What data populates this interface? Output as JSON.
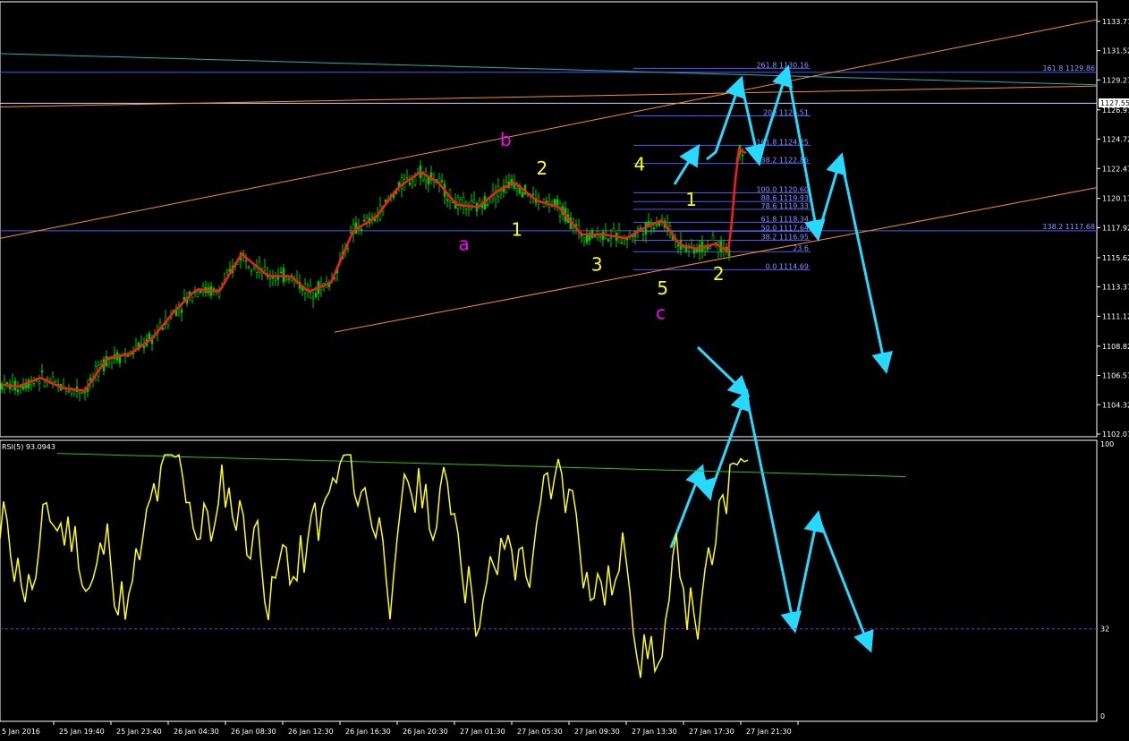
{
  "chart_data": [
    {
      "type": "candlestick",
      "panel": "price",
      "ylim": [
        1102.0,
        1135.0
      ],
      "y_ticks": [
        "1133.77",
        "1131.52",
        "1129.27",
        "1126.97",
        "1124.72",
        "1122.47",
        "1120.17",
        "1117.92",
        "1115.62",
        "1113.37",
        "1111.12",
        "1108.82",
        "1106.57",
        "1104.32",
        "1102.07"
      ],
      "current_price_label": "1127.55",
      "series_red_ma_note": "",
      "wave_labels": [
        {
          "text": "a",
          "color": "#ff00ff",
          "price": 1116.2,
          "t": 0.418
        },
        {
          "text": "b",
          "color": "#ff00ff",
          "price": 1124.2,
          "t": 0.456
        },
        {
          "text": "c",
          "color": "#ff00ff",
          "price": 1110.9,
          "t": 0.598
        },
        {
          "text": "1",
          "color": "#ffff00",
          "price": 1117.3,
          "t": 0.466
        },
        {
          "text": "2",
          "color": "#ffff00",
          "price": 1122.0,
          "t": 0.489
        },
        {
          "text": "3",
          "color": "#ffff00",
          "price": 1114.6,
          "t": 0.539
        },
        {
          "text": "4",
          "color": "#ffff00",
          "price": 1122.3,
          "t": 0.578
        },
        {
          "text": "5",
          "color": "#ffff00",
          "price": 1112.8,
          "t": 0.599
        },
        {
          "text": "1",
          "color": "#ffff00",
          "price": 1119.6,
          "t": 0.625
        },
        {
          "text": "2",
          "color": "#ffff00",
          "price": 1113.9,
          "t": 0.65
        }
      ],
      "fib_levels": [
        {
          "label": "261.8  1130.16",
          "price": 1130.16
        },
        {
          "label": "200  1126.51",
          "price": 1126.51
        },
        {
          "label": "161.8  1124.25",
          "price": 1124.25
        },
        {
          "label": "138.2  1122.86",
          "price": 1122.86
        },
        {
          "label": "100.0  1120.60",
          "price": 1120.6
        },
        {
          "label": "88.6  1119.93",
          "price": 1119.93
        },
        {
          "label": "78.6  1119.33",
          "price": 1119.33
        },
        {
          "label": "61.8  1118.34",
          "price": 1118.34
        },
        {
          "label": "50.0  1117.64",
          "price": 1117.64
        },
        {
          "label": "38.2  1116.95",
          "price": 1116.95
        },
        {
          "label": "23.6",
          "price": 1116.08
        },
        {
          "label": "0.0  1114.69",
          "price": 1114.69
        }
      ],
      "horizontal_lines": [
        {
          "label": "161.8  1129.86",
          "price": 1129.86
        },
        {
          "label": "138.2  1117.68",
          "price": 1117.68
        }
      ],
      "colors": {
        "candles": "#00c800",
        "ma": "#ff1a1a",
        "fib": "#4b57ff",
        "channel": "#ff8c1a",
        "trend": "#1ab3b3",
        "arrows": "#27d8ff",
        "rsi": "#ffff00",
        "rsi_trend": "#22c41f"
      }
    },
    {
      "type": "line",
      "panel": "rsi",
      "title": "RSI(5) 93.0943",
      "ylim": [
        0,
        100
      ],
      "y_ticks": [
        "100",
        "32",
        "0"
      ],
      "level": 32
    }
  ],
  "x_axis": {
    "labels": [
      "5 Jan 2016",
      "25 Jan 19:40",
      "25 Jan 23:40",
      "26 Jan 04:30",
      "26 Jan 08:30",
      "26 Jan 12:30",
      "26 Jan 16:30",
      "26 Jan 20:30",
      "27 Jan 01:30",
      "27 Jan 05:30",
      "27 Jan 09:30",
      "27 Jan 13:30",
      "27 Jan 17:30",
      "27 Jan 21:30"
    ]
  }
}
